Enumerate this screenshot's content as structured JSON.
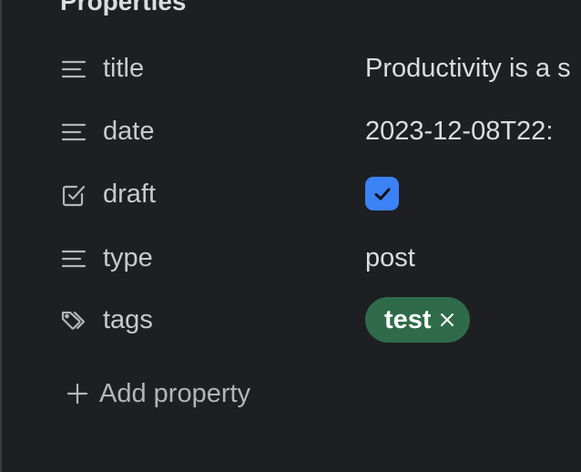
{
  "panel": {
    "heading": "Properties"
  },
  "properties": [
    {
      "key": "title",
      "icon": "text-lines-icon",
      "value": "Productivity is a s"
    },
    {
      "key": "date",
      "icon": "text-lines-icon",
      "value": "2023-12-08T22:"
    },
    {
      "key": "draft",
      "icon": "checkbox-icon",
      "checked": true
    },
    {
      "key": "type",
      "icon": "text-lines-icon",
      "value": "post"
    },
    {
      "key": "tags",
      "icon": "tags-icon",
      "tags": [
        "test"
      ]
    }
  ],
  "add_property": {
    "label": "Add property"
  },
  "colors": {
    "background": "#1e1f22",
    "checkbox": "#3b82f6",
    "tag_pill": "#2f6b4a",
    "text": "#dcddde"
  }
}
